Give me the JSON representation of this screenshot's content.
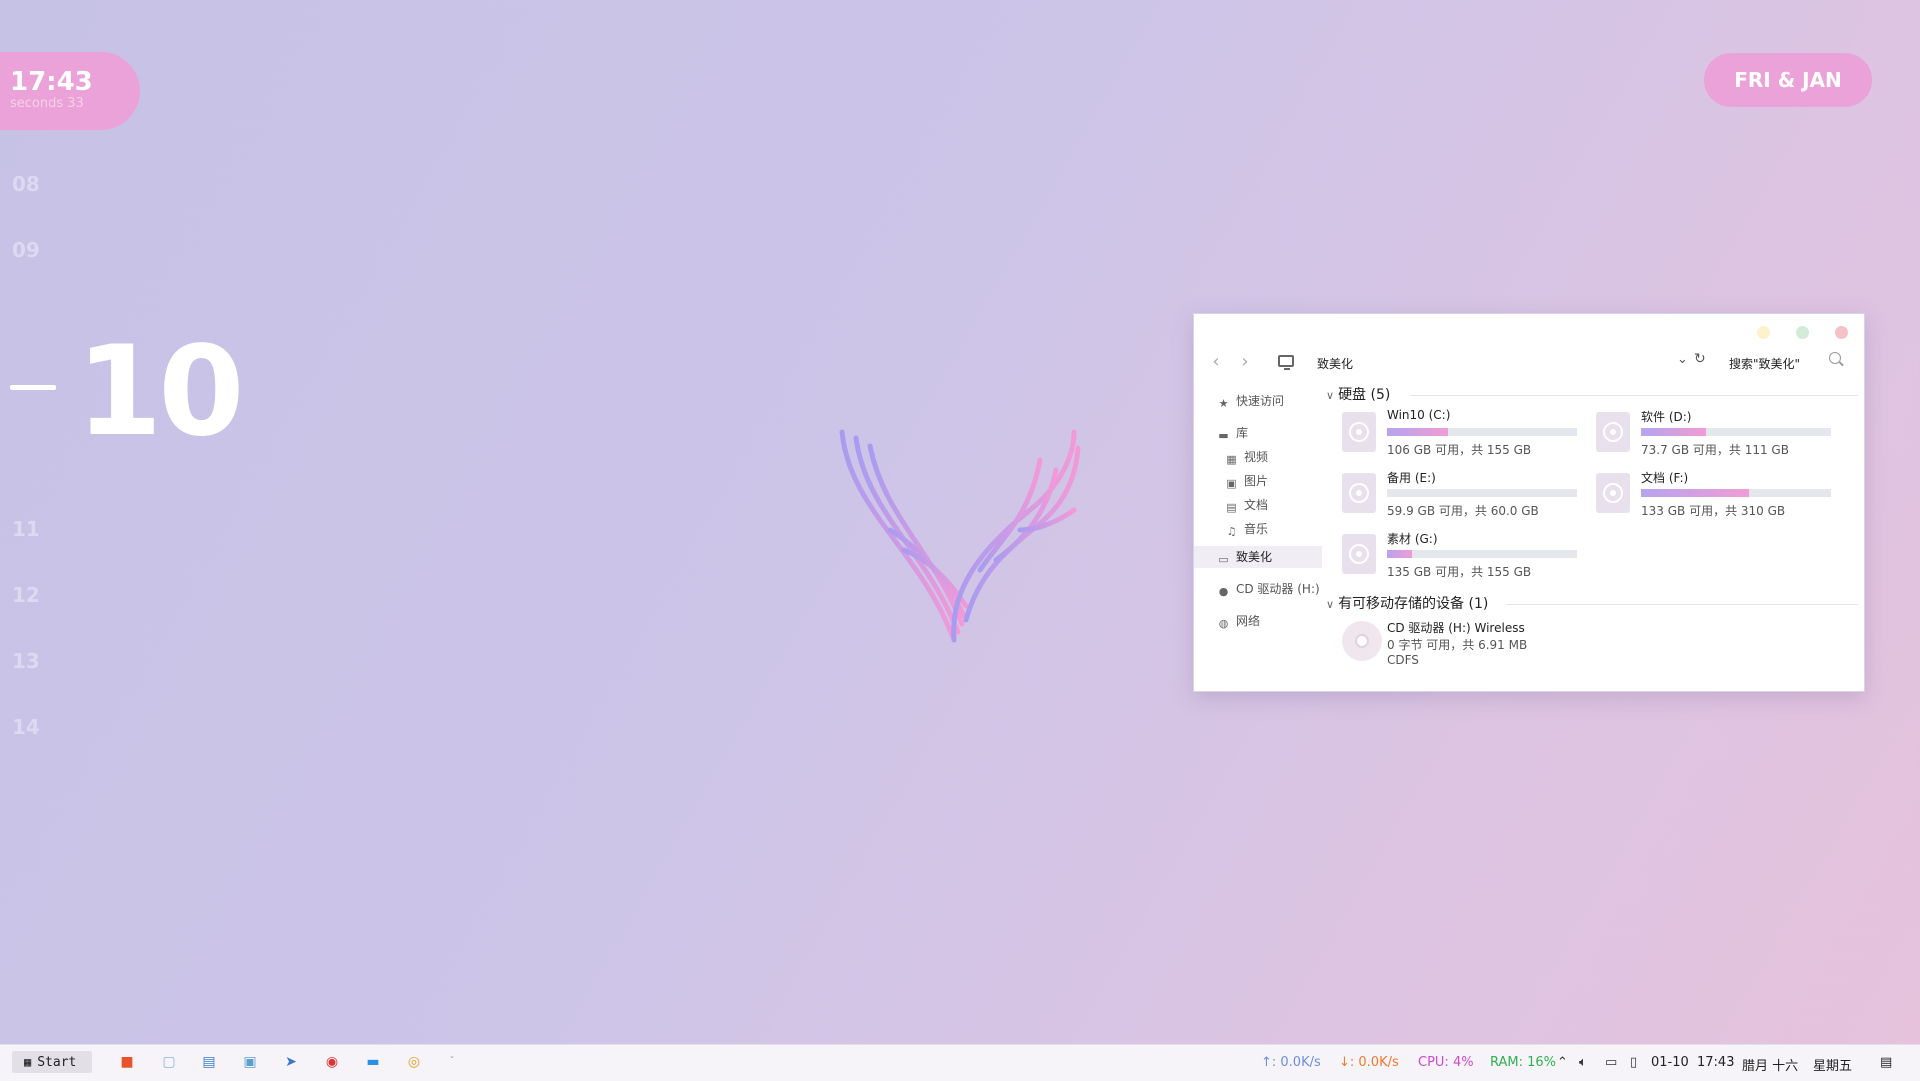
{
  "clock": {
    "time": "17:43",
    "seconds": "seconds 33"
  },
  "date_pill": "FRI & JAN",
  "hours": {
    "h08": "08",
    "h09": "09",
    "current": "10",
    "h11": "11",
    "h12": "12",
    "h13": "13",
    "h14": "14"
  },
  "explorer": {
    "address": "致美化",
    "search_placeholder": "搜索\"致美化\"",
    "sidebar": {
      "quick_access": "快速访问",
      "library": "库",
      "videos": "视频",
      "pictures": "图片",
      "documents": "文档",
      "music": "音乐",
      "this_pc": "致美化",
      "cd_drive": "CD 驱动器 (H:)",
      "network": "网络"
    },
    "hard_drives": {
      "header": "硬盘 (5)",
      "drives": [
        {
          "name": "Win10 (C:)",
          "free": "106 GB 可用，共 155 GB",
          "used": 0.32
        },
        {
          "name": "软件 (D:)",
          "free": "73.7 GB 可用，共 111 GB",
          "used": 0.34
        },
        {
          "name": "备用 (E:)",
          "free": "59.9 GB 可用，共 60.0 GB",
          "used": 0.0
        },
        {
          "name": "文档 (F:)",
          "free": "133 GB 可用，共 310 GB",
          "used": 0.57
        },
        {
          "name": "素材 (G:)",
          "free": "135 GB 可用，共 155 GB",
          "used": 0.13
        }
      ]
    },
    "removable": {
      "header": "有可移动存储的设备 (1)",
      "device": {
        "name": "CD 驱动器 (H:) Wireless",
        "free": "0 字节 可用，共 6.91 MB",
        "fs": "CDFS"
      }
    }
  },
  "taskbar": {
    "start_label": "Start",
    "upload": "↑: 0.0K/s",
    "download": "↓: 0.0K/s",
    "cpu": "CPU: 4%",
    "ram": "RAM: 16%",
    "date": "01-10",
    "time": "17:43",
    "lunar": "腊月 十六",
    "weekday": "星期五"
  },
  "colors": {
    "accent_pink": "#eba2d8",
    "upload": "#6a8fe0",
    "download": "#f0782c",
    "cpu": "#d04ad0",
    "ram": "#30b050"
  }
}
